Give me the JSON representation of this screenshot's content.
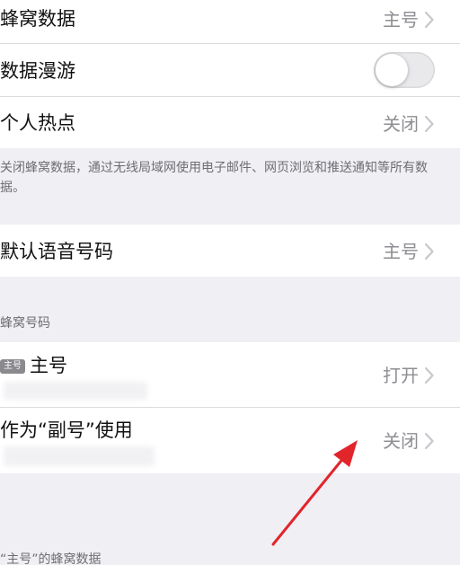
{
  "cellular_data": {
    "label": "蜂窝数据",
    "value": "主号"
  },
  "data_roaming": {
    "label": "数据漫游",
    "enabled": false
  },
  "personal_hotspot": {
    "label": "个人热点",
    "value": "关闭"
  },
  "cellular_note": "关闭蜂窝数据，通过无线局域网使用电子邮件、网页浏览和推送通知等所有数据。",
  "default_voice": {
    "label": "默认语音号码",
    "value": "主号"
  },
  "cellular_plans": {
    "section_header": "蜂窝号码",
    "primary": {
      "badge": "主号",
      "label": "主号",
      "value": "打开"
    },
    "secondary": {
      "label": "作为“副号”使用",
      "value": "关闭"
    }
  },
  "footer_header": "“主号”的蜂窝数据",
  "colors": {
    "background": "#efeff4",
    "separator": "#dcdce0",
    "annotation_arrow": "#e2252b"
  },
  "icons": {
    "chevron": "chevron-right-icon",
    "annotation": "red-arrow-annotation"
  }
}
